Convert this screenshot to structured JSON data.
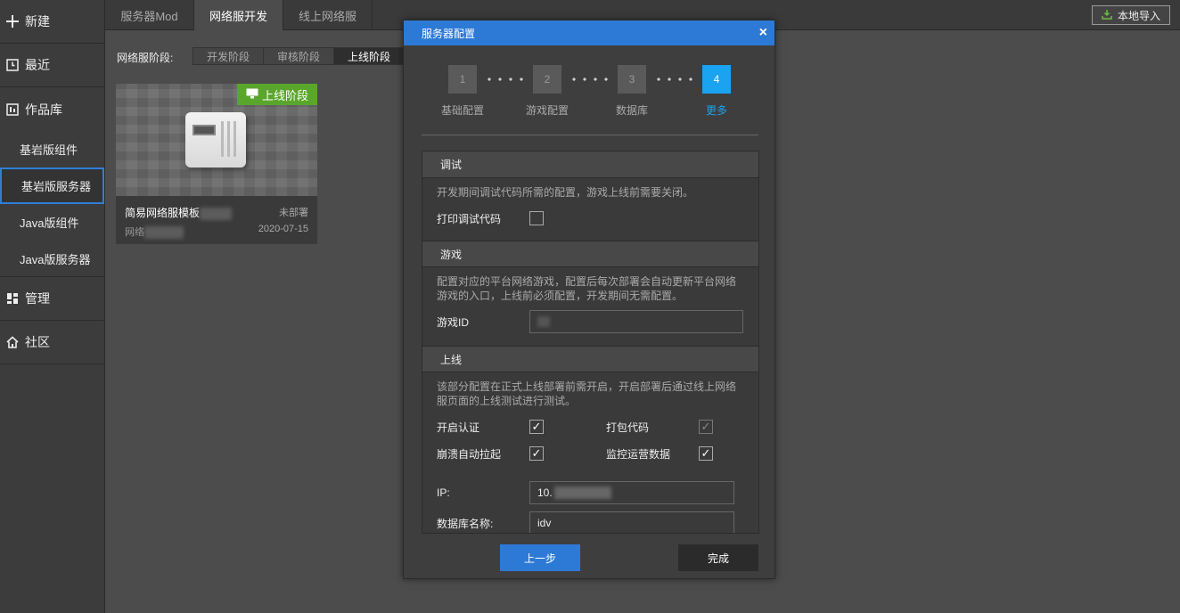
{
  "sidebar": {
    "items": [
      {
        "icon": "plus-icon",
        "label": "新建"
      },
      {
        "icon": "clock-icon",
        "label": "最近"
      },
      {
        "icon": "library-icon",
        "label": "作品库"
      }
    ],
    "sub_items": [
      "基岩版组件",
      "基岩版服务器",
      "Java版组件",
      "Java版服务器"
    ],
    "active_sub": "基岩版服务器",
    "bottom_items": [
      {
        "icon": "grid-icon",
        "label": "管理"
      },
      {
        "icon": "home-icon",
        "label": "社区"
      }
    ]
  },
  "top_tabs": [
    "服务器Mod",
    "网络服开发",
    "线上网络服"
  ],
  "active_tab": "网络服开发",
  "import_button": "本地导入",
  "stage": {
    "label": "网络服阶段:",
    "tabs": [
      "开发阶段",
      "审核阶段",
      "上线阶段"
    ],
    "active": "上线阶段"
  },
  "card": {
    "badge": "上线阶段",
    "title": "简易网络服模板",
    "status": "未部署",
    "subtitle": "网络",
    "date": "2020-07-15"
  },
  "dialog": {
    "title": "服务器配置",
    "close": "×",
    "steps": [
      {
        "num": "1",
        "label": "基础配置"
      },
      {
        "num": "2",
        "label": "游戏配置"
      },
      {
        "num": "3",
        "label": "数据库"
      },
      {
        "num": "4",
        "label": "更多"
      }
    ],
    "active_step": 4,
    "sections": {
      "debug": {
        "title": "调试",
        "desc": "开发期间调试代码所需的配置，游戏上线前需要关闭。",
        "print_debug_label": "打印调试代码",
        "print_debug_checked": false
      },
      "game": {
        "title": "游戏",
        "desc": "配置对应的平台网络游戏，配置后每次部署会自动更新平台网络游戏的入口，上线前必须配置，开发期间无需配置。",
        "game_id_label": "游戏ID",
        "game_id_value": ""
      },
      "online": {
        "title": "上线",
        "desc": "该部分配置在正式上线部署前需开启，开启部署后通过线上网络服页面的上线测试进行测试。",
        "auth_label": "开启认证",
        "auth_checked": true,
        "pack_label": "打包代码",
        "pack_checked": true,
        "restart_label": "崩溃自动拉起",
        "restart_checked": true,
        "monitor_label": "监控运营数据",
        "monitor_checked": true,
        "ip_label": "IP:",
        "ip_value": "10.",
        "db_label": "数据库名称:",
        "db_value": "idv"
      }
    },
    "prev_button": "上一步",
    "done_button": "完成"
  },
  "colors": {
    "accent": "#2d7ad6",
    "step_active": "#1aa3f0",
    "badge_green": "#5aa62c"
  }
}
